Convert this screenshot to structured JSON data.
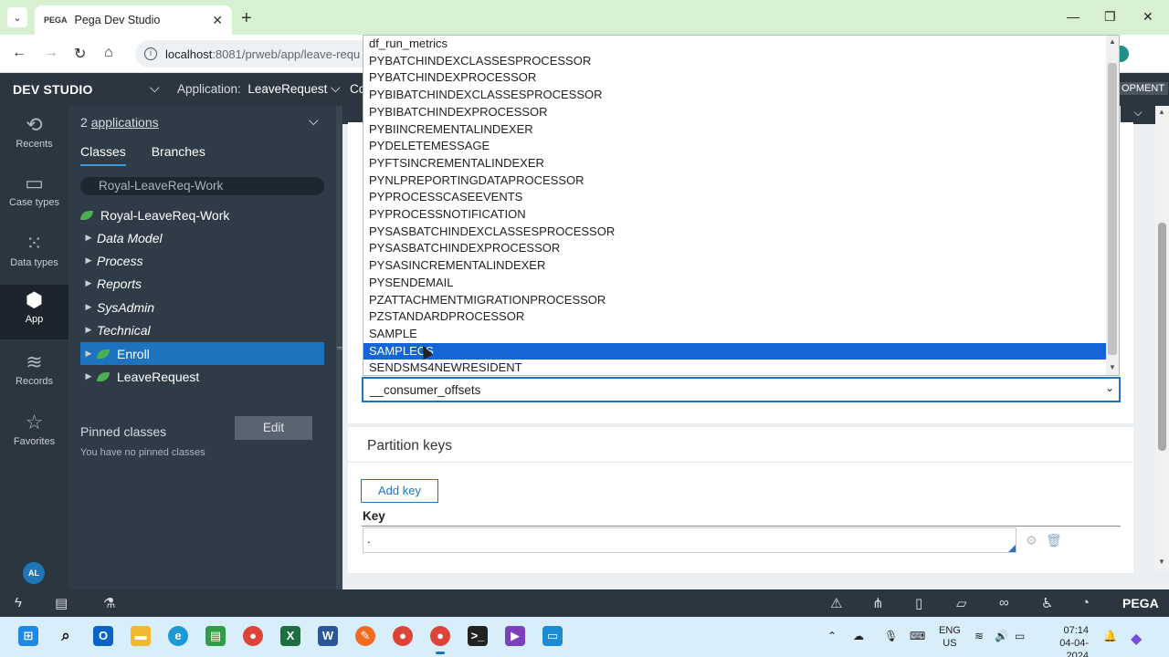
{
  "browser": {
    "tab_title": "Pega Dev Studio",
    "favicon": "PEGA",
    "url_host": "localhost",
    "url_rest": ":8081/prweb/app/leave-requ"
  },
  "header": {
    "brand": "DEV STUDIO",
    "app_prefix": "Application:",
    "app_name": "LeaveRequest",
    "truncated": "Co",
    "right_badge": "OPMENT"
  },
  "rail": [
    {
      "label": "Recents",
      "icon": "history-icon"
    },
    {
      "label": "Case types",
      "icon": "case-types-icon"
    },
    {
      "label": "Data types",
      "icon": "data-types-icon"
    },
    {
      "label": "App",
      "icon": "app-cube-icon"
    },
    {
      "label": "Records",
      "icon": "records-stack-icon"
    },
    {
      "label": "Favorites",
      "icon": "star-icon"
    }
  ],
  "avatar": "AL",
  "explorer": {
    "apps_count": "2",
    "apps_label": "applications",
    "tab_classes": "Classes",
    "tab_branches": "Branches",
    "search_value": "Royal-LeaveReq-Work",
    "tree": [
      {
        "label": "Royal-LeaveReq-Work",
        "leaf": true,
        "arrow": false,
        "italic": false
      },
      {
        "label": "Data Model",
        "leaf": false,
        "arrow": true,
        "italic": true
      },
      {
        "label": "Process",
        "leaf": false,
        "arrow": true,
        "italic": true
      },
      {
        "label": "Reports",
        "leaf": false,
        "arrow": true,
        "italic": true
      },
      {
        "label": "SysAdmin",
        "leaf": false,
        "arrow": true,
        "italic": true
      },
      {
        "label": "Technical",
        "leaf": false,
        "arrow": true,
        "italic": true
      },
      {
        "label": "Enroll",
        "leaf": true,
        "arrow": true,
        "italic": false,
        "selected": true
      },
      {
        "label": "LeaveRequest",
        "leaf": true,
        "arrow": true,
        "italic": false
      }
    ],
    "pinned_title": "Pinned classes",
    "edit_label": "Edit",
    "no_pinned": "You have no pinned classes"
  },
  "dropdown": {
    "options": [
      "df_run_metrics",
      "PYBATCHINDEXCLASSESPROCESSOR",
      "PYBATCHINDEXPROCESSOR",
      "PYBIBATCHINDEXCLASSESPROCESSOR",
      "PYBIBATCHINDEXPROCESSOR",
      "PYBIINCREMENTALINDEXER",
      "PYDELETEMESSAGE",
      "PYFTSINCREMENTALINDEXER",
      "PYNLPREPORTINGDATAPROCESSOR",
      "PYPROCESSCASEEVENTS",
      "PYPROCESSNOTIFICATION",
      "PYSASBATCHINDEXCLASSESPROCESSOR",
      "PYSASBATCHINDEXPROCESSOR",
      "PYSASINCREMENTALINDEXER",
      "PYSENDEMAIL",
      "PZATTACHMENTMIGRATIONPROCESSOR",
      "PZSTANDARDPROCESSOR",
      "SAMPLE",
      "SAMPLECS",
      "SENDSMS4NEWRESIDENT"
    ],
    "highlighted_index": 18,
    "selected_value": "__consumer_offsets"
  },
  "partition": {
    "title": "Partition keys",
    "add_key": "Add key",
    "key_label": "Key",
    "key_value": "."
  },
  "footer": {
    "brand": "PEGA"
  },
  "taskbar": {
    "lang_top": "ENG",
    "lang_bottom": "US",
    "time": "07:14",
    "date": "04-04-2024"
  }
}
